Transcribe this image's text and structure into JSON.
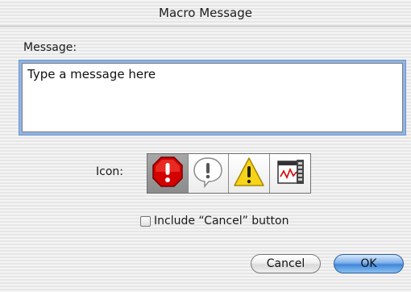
{
  "window": {
    "title": "Macro Message"
  },
  "message": {
    "label": "Message:",
    "value": "Type a message here"
  },
  "icon_picker": {
    "label": "Icon:",
    "options": [
      {
        "name": "stop-icon",
        "selected": true
      },
      {
        "name": "note-icon",
        "selected": false
      },
      {
        "name": "caution-icon",
        "selected": false
      },
      {
        "name": "application-icon",
        "selected": false
      }
    ]
  },
  "cancel_option": {
    "label": "Include “Cancel” button",
    "checked": false
  },
  "buttons": {
    "cancel": "Cancel",
    "ok": "OK"
  },
  "colors": {
    "stop_red": "#d40000",
    "caution_yellow": "#f7d417",
    "default_button_blue": "#3f87d9"
  }
}
